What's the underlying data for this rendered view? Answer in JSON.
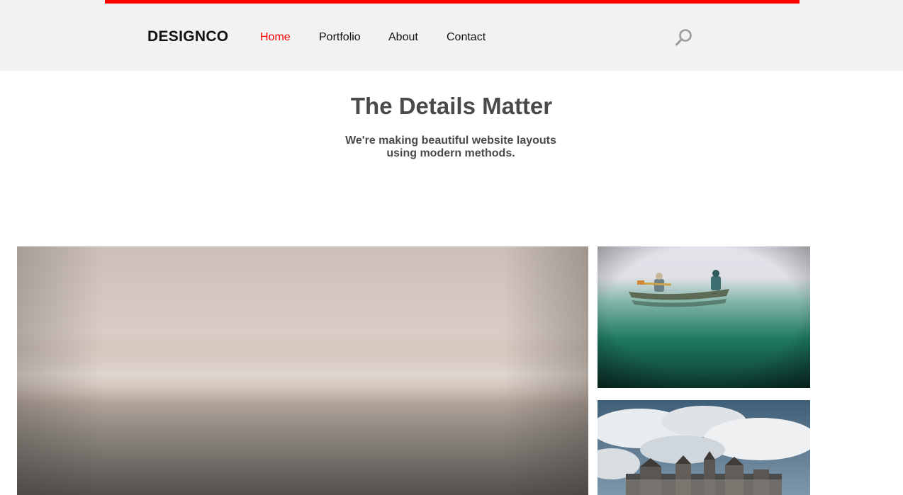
{
  "header": {
    "logo": "DESIGNCO",
    "nav": [
      {
        "label": "Home",
        "active": true
      },
      {
        "label": "Portfolio",
        "active": false
      },
      {
        "label": "About",
        "active": false
      },
      {
        "label": "Contact",
        "active": false
      }
    ],
    "search_icon": "search-icon"
  },
  "hero": {
    "title": "The Details Matter",
    "subtitle_line1": "We're making beautiful website layouts",
    "subtitle_line2": "using modern methods."
  },
  "colors": {
    "accent": "#ff0000",
    "header_bg": "#f2f2f2",
    "heading_text": "#4a4a4a"
  }
}
